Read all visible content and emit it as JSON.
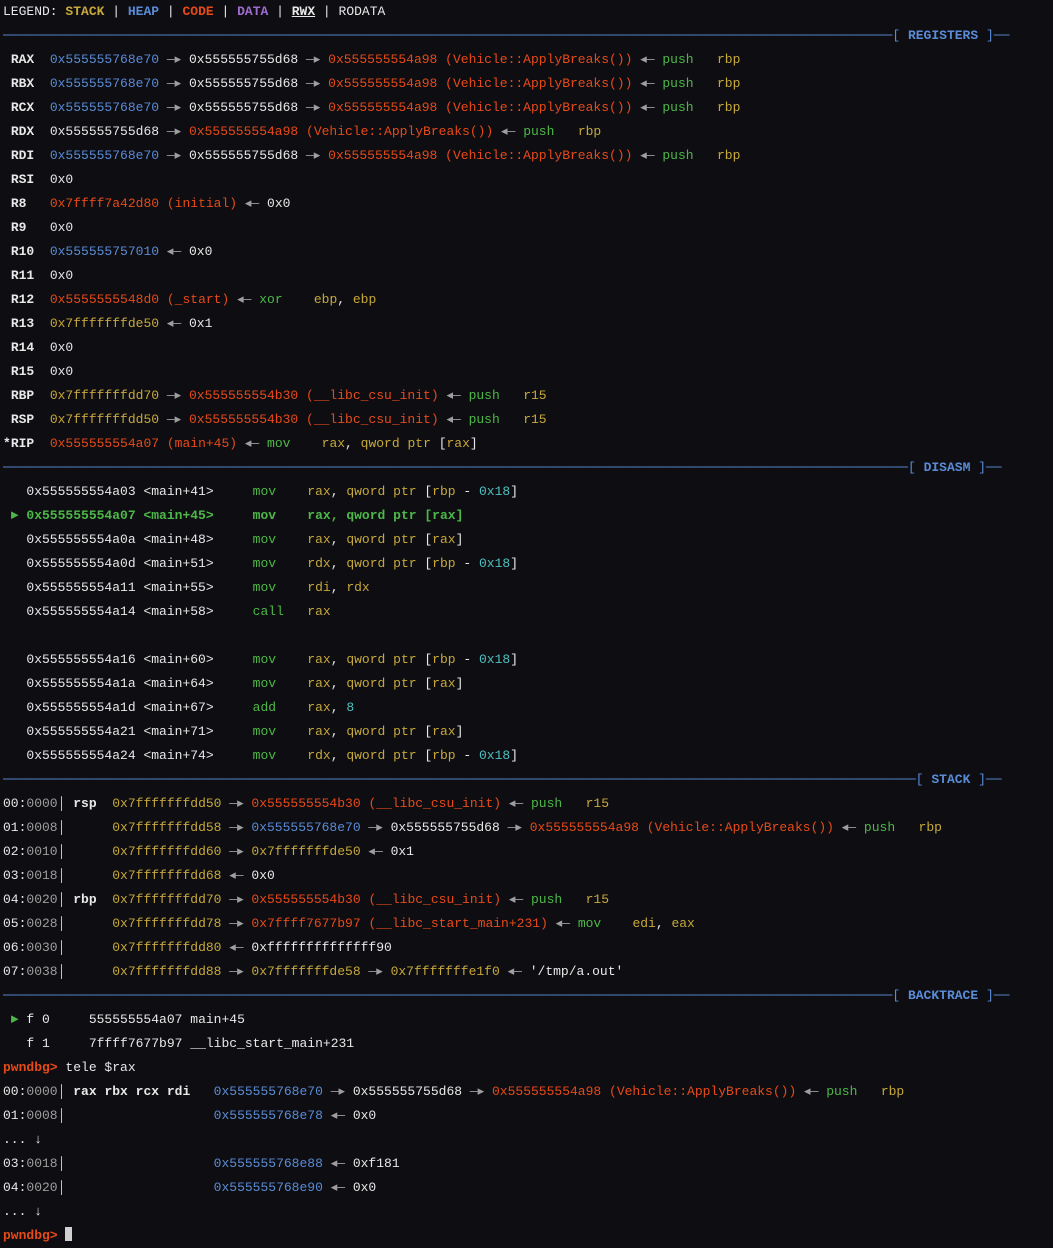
{
  "legend": {
    "prefix": "LEGEND: ",
    "stack": "STACK",
    "heap": "HEAP",
    "code": "CODE",
    "data": "DATA",
    "rwx": "RWX",
    "rodata": "RODATA",
    "sep": " | "
  },
  "sections": {
    "registers": "REGISTERS",
    "disasm": "DISASM",
    "stack": "STACK",
    "backtrace": "BACKTRACE"
  },
  "registers": {
    "rax": {
      "name": "RAX",
      "v1": "0x555555768e70",
      "v2": "0x555555755d68",
      "v3addr": "0x555555554a98",
      "v3sym": "(Vehicle::ApplyBreaks())",
      "i1": "push",
      "i2": "rbp"
    },
    "rbx": {
      "name": "RBX",
      "v1": "0x555555768e70",
      "v2": "0x555555755d68",
      "v3addr": "0x555555554a98",
      "v3sym": "(Vehicle::ApplyBreaks())",
      "i1": "push",
      "i2": "rbp"
    },
    "rcx": {
      "name": "RCX",
      "v1": "0x555555768e70",
      "v2": "0x555555755d68",
      "v3addr": "0x555555554a98",
      "v3sym": "(Vehicle::ApplyBreaks())",
      "i1": "push",
      "i2": "rbp"
    },
    "rdx": {
      "name": "RDX",
      "v1w": "0x555555755d68",
      "v3addr": "0x555555554a98",
      "v3sym": "(Vehicle::ApplyBreaks())",
      "i1": "push",
      "i2": "rbp"
    },
    "rdi": {
      "name": "RDI",
      "v1": "0x555555768e70",
      "v2": "0x555555755d68",
      "v3addr": "0x555555554a98",
      "v3sym": "(Vehicle::ApplyBreaks())",
      "i1": "push",
      "i2": "rbp"
    },
    "rsi": {
      "name": "RSI",
      "zero": "0x0"
    },
    "r8": {
      "name": "R8",
      "addr": "0x7ffff7a42d80",
      "sym": "(initial)",
      "zero": "0x0"
    },
    "r9": {
      "name": "R9",
      "zero": "0x0"
    },
    "r10": {
      "name": "R10",
      "addr": "0x555555757010",
      "zero": "0x0"
    },
    "r11": {
      "name": "R11",
      "zero": "0x0"
    },
    "r12": {
      "name": "R12",
      "addr": "0x5555555548d0",
      "sym": "(_start)",
      "i1": "xor",
      "i2": "ebp",
      "i3": "ebp"
    },
    "r13": {
      "name": "R13",
      "addr": "0x7fffffffde50",
      "one": "0x1"
    },
    "r14": {
      "name": "R14",
      "zero": "0x0"
    },
    "r15": {
      "name": "R15",
      "zero": "0x0"
    },
    "rbp": {
      "name": "RBP",
      "addr": "0x7fffffffdd70",
      "v3addr": "0x555555554b30",
      "v3sym": "(__libc_csu_init)",
      "i1": "push",
      "i2": "r15"
    },
    "rsp": {
      "name": "RSP",
      "addr": "0x7fffffffdd50",
      "v3addr": "0x555555554b30",
      "v3sym": "(__libc_csu_init)",
      "i1": "push",
      "i2": "r15"
    },
    "rip": {
      "star": "*",
      "name": "RIP",
      "addr": "0x555555554a07",
      "sym": "(main+45)",
      "i1": "mov",
      "i2": "rax",
      "comma": ", ",
      "i3": "qword",
      "i4": "ptr",
      "lb": " [",
      "i5": "rax",
      "rb": "]"
    }
  },
  "disasm": [
    {
      "ptr": "   ",
      "addr": "0x555555554a03",
      "off": "<main+41>",
      "m": "mov",
      "r1": "rax",
      "c1": ", ",
      "q": "qword",
      "p": "ptr",
      "lb": " [",
      "r2": "rbp",
      "dash": " - ",
      "n": "0x18",
      "rb": "]"
    },
    {
      "ptr": " ► ",
      "addr": "0x555555554a07",
      "off": "<main+45>",
      "m": "mov",
      "r1": "rax",
      "c1": ", ",
      "q": "qword",
      "p": "ptr",
      "lb": " [",
      "r2": "rax",
      "rb": "]",
      "hl": true
    },
    {
      "ptr": "   ",
      "addr": "0x555555554a0a",
      "off": "<main+48>",
      "m": "mov",
      "r1": "rax",
      "c1": ", ",
      "q": "qword",
      "p": "ptr",
      "lb": " [",
      "r2": "rax",
      "rb": "]"
    },
    {
      "ptr": "   ",
      "addr": "0x555555554a0d",
      "off": "<main+51>",
      "m": "mov",
      "r1": "rdx",
      "c1": ", ",
      "q": "qword",
      "p": "ptr",
      "lb": " [",
      "r2": "rbp",
      "dash": " - ",
      "n": "0x18",
      "rb": "]"
    },
    {
      "ptr": "   ",
      "addr": "0x555555554a11",
      "off": "<main+55>",
      "m": "mov",
      "r1": "rdi",
      "c1": ", ",
      "r2s": "rdx"
    },
    {
      "ptr": "   ",
      "addr": "0x555555554a14",
      "off": "<main+58>",
      "m": "call",
      "r1": "rax"
    },
    {
      "blank": " "
    },
    {
      "ptr": "   ",
      "addr": "0x555555554a16",
      "off": "<main+60>",
      "m": "mov",
      "r1": "rax",
      "c1": ", ",
      "q": "qword",
      "p": "ptr",
      "lb": " [",
      "r2": "rbp",
      "dash": " - ",
      "n": "0x18",
      "rb": "]"
    },
    {
      "ptr": "   ",
      "addr": "0x555555554a1a",
      "off": "<main+64>",
      "m": "mov",
      "r1": "rax",
      "c1": ", ",
      "q": "qword",
      "p": "ptr",
      "lb": " [",
      "r2": "rax",
      "rb": "]"
    },
    {
      "ptr": "   ",
      "addr": "0x555555554a1d",
      "off": "<main+67>",
      "m": "add",
      "r1": "rax",
      "c1": ", ",
      "n": "8"
    },
    {
      "ptr": "   ",
      "addr": "0x555555554a21",
      "off": "<main+71>",
      "m": "mov",
      "r1": "rax",
      "c1": ", ",
      "q": "qword",
      "p": "ptr",
      "lb": " [",
      "r2": "rax",
      "rb": "]"
    },
    {
      "ptr": "   ",
      "addr": "0x555555554a24",
      "off": "<main+74>",
      "m": "mov",
      "r1": "rdx",
      "c1": ", ",
      "q": "qword",
      "p": "ptr",
      "lb": " [",
      "r2": "rbp",
      "dash": " - ",
      "n": "0x18",
      "rb": "]"
    }
  ],
  "stack": [
    {
      "idx": "00:",
      "off": "0000",
      "reg": "rsp",
      "addr": "0x7fffffffdd50",
      "arr1": " —▸ ",
      "c_addr": "0x555555554b30",
      "c_sym": "(__libc_csu_init)",
      "arr2": " ◂— ",
      "i1": "push",
      "pad": "   ",
      "i2": "r15"
    },
    {
      "idx": "01:",
      "off": "0008",
      "reg": "",
      "addr": "0x7fffffffdd58",
      "arr1": " —▸ ",
      "h_addr": "0x555555768e70",
      "arr2": " —▸ ",
      "w_addr": "0x555555755d68",
      "arr3": " —▸ ",
      "c_addr": "0x555555554a98",
      "c_sym": "(Vehicle::ApplyBreaks())",
      "arr4": " ◂— ",
      "i1": "push",
      "pad": "   ",
      "i2": "rbp"
    },
    {
      "idx": "02:",
      "off": "0010",
      "reg": "",
      "addr": "0x7fffffffdd60",
      "arr1": " —▸ ",
      "y_addr": "0x7fffffffde50",
      "arr2": " ◂— ",
      "v1": "0x1"
    },
    {
      "idx": "03:",
      "off": "0018",
      "reg": "",
      "addr": "0x7fffffffdd68",
      "arr2": " ◂— ",
      "v1": "0x0"
    },
    {
      "idx": "04:",
      "off": "0020",
      "reg": "rbp",
      "addr": "0x7fffffffdd70",
      "arr1": " —▸ ",
      "c_addr": "0x555555554b30",
      "c_sym": "(__libc_csu_init)",
      "arr2": " ◂— ",
      "i1": "push",
      "pad": "   ",
      "i2": "r15"
    },
    {
      "idx": "05:",
      "off": "0028",
      "reg": "",
      "addr": "0x7fffffffdd78",
      "arr1": " —▸ ",
      "c_addr": "0x7ffff7677b97",
      "c_sym": "(__libc_start_main+231)",
      "arr2": " ◂— ",
      "i1": "mov",
      "pad": "    ",
      "i2": "edi",
      "comma": ", ",
      "i3": "eax"
    },
    {
      "idx": "06:",
      "off": "0030",
      "reg": "",
      "addr": "0x7fffffffdd80",
      "arr2": " ◂— ",
      "v1": "0xffffffffffffff90"
    },
    {
      "idx": "07:",
      "off": "0038",
      "reg": "",
      "addr": "0x7fffffffdd88",
      "arr1": " —▸ ",
      "y_addr": "0x7fffffffde58",
      "arr3": " —▸ ",
      "y_addr2": "0x7fffffffe1f0",
      "arr2": " ◂— ",
      "str": "'/tmp/a.out'"
    }
  ],
  "backtrace": {
    "f0": {
      "ptr": " ► ",
      "f": "f 0",
      "addr": "555555554a07",
      "sym": "main+45"
    },
    "f1": {
      "ptr": "   ",
      "f": "f 1",
      "addr": "7ffff7677b97",
      "sym": "__libc_start_main+231"
    }
  },
  "prompt": "pwndbg> ",
  "cmd": "tele $rax",
  "tele": [
    {
      "idx": "00:",
      "off": "0000",
      "regs": "rax rbx rcx rdi",
      "addr": "0x555555768e70",
      "arr1": " —▸ ",
      "w_addr": "0x555555755d68",
      "arr2": " —▸ ",
      "c_addr": "0x555555554a98",
      "c_sym": "(Vehicle::ApplyBreaks())",
      "arr3": " ◂— ",
      "i1": "push",
      "pad": "   ",
      "i2": "rbp"
    },
    {
      "idx": "01:",
      "off": "0008",
      "regs": "",
      "addr": "0x555555768e78",
      "arrb": " ◂— ",
      "val": "0x0"
    },
    {
      "skip": "... ↓"
    },
    {
      "idx": "03:",
      "off": "0018",
      "regs": "",
      "addr": "0x555555768e88",
      "arrb": " ◂— ",
      "val": "0xf181"
    },
    {
      "idx": "04:",
      "off": "0020",
      "regs": "",
      "addr": "0x555555768e90",
      "arrb": " ◂— ",
      "val": "0x0"
    },
    {
      "skip": "... ↓"
    }
  ]
}
